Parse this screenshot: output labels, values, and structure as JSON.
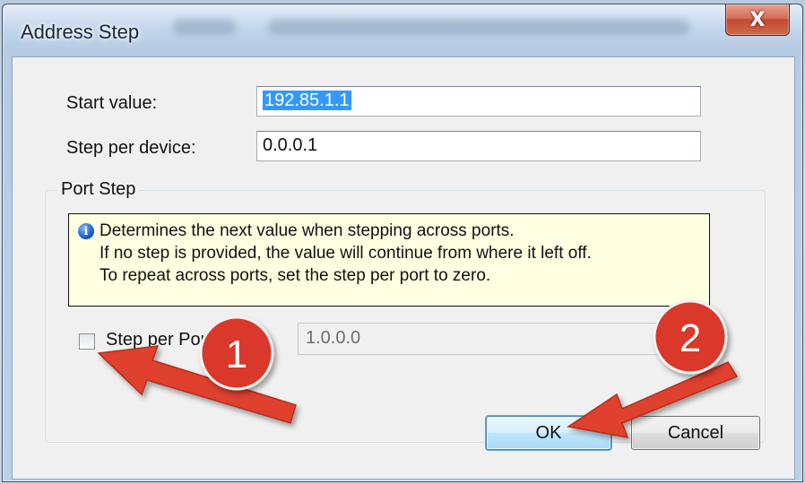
{
  "window": {
    "title": "Address Step",
    "close_glyph": "X"
  },
  "fields": {
    "start_label": "Start value:",
    "start_value": "192.85.1.1",
    "step_label": "Step per device:",
    "step_value": "0.0.0.1"
  },
  "port_step": {
    "legend": "Port Step",
    "info_icon": "info-icon",
    "info_lines": [
      "Determines the next value when stepping across ports.",
      "If no step is provided, the value will continue from where it left off.",
      "To repeat across ports, set the step per port to zero."
    ],
    "checkbox_label": "Step per Port",
    "checkbox_checked": false,
    "port_value": "1.0.0.0"
  },
  "buttons": {
    "ok": "OK",
    "cancel": "Cancel"
  },
  "annotations": {
    "badge1": "1",
    "badge2": "2",
    "badge_color": "#d9382a",
    "arrow_color": "#e0402f"
  }
}
